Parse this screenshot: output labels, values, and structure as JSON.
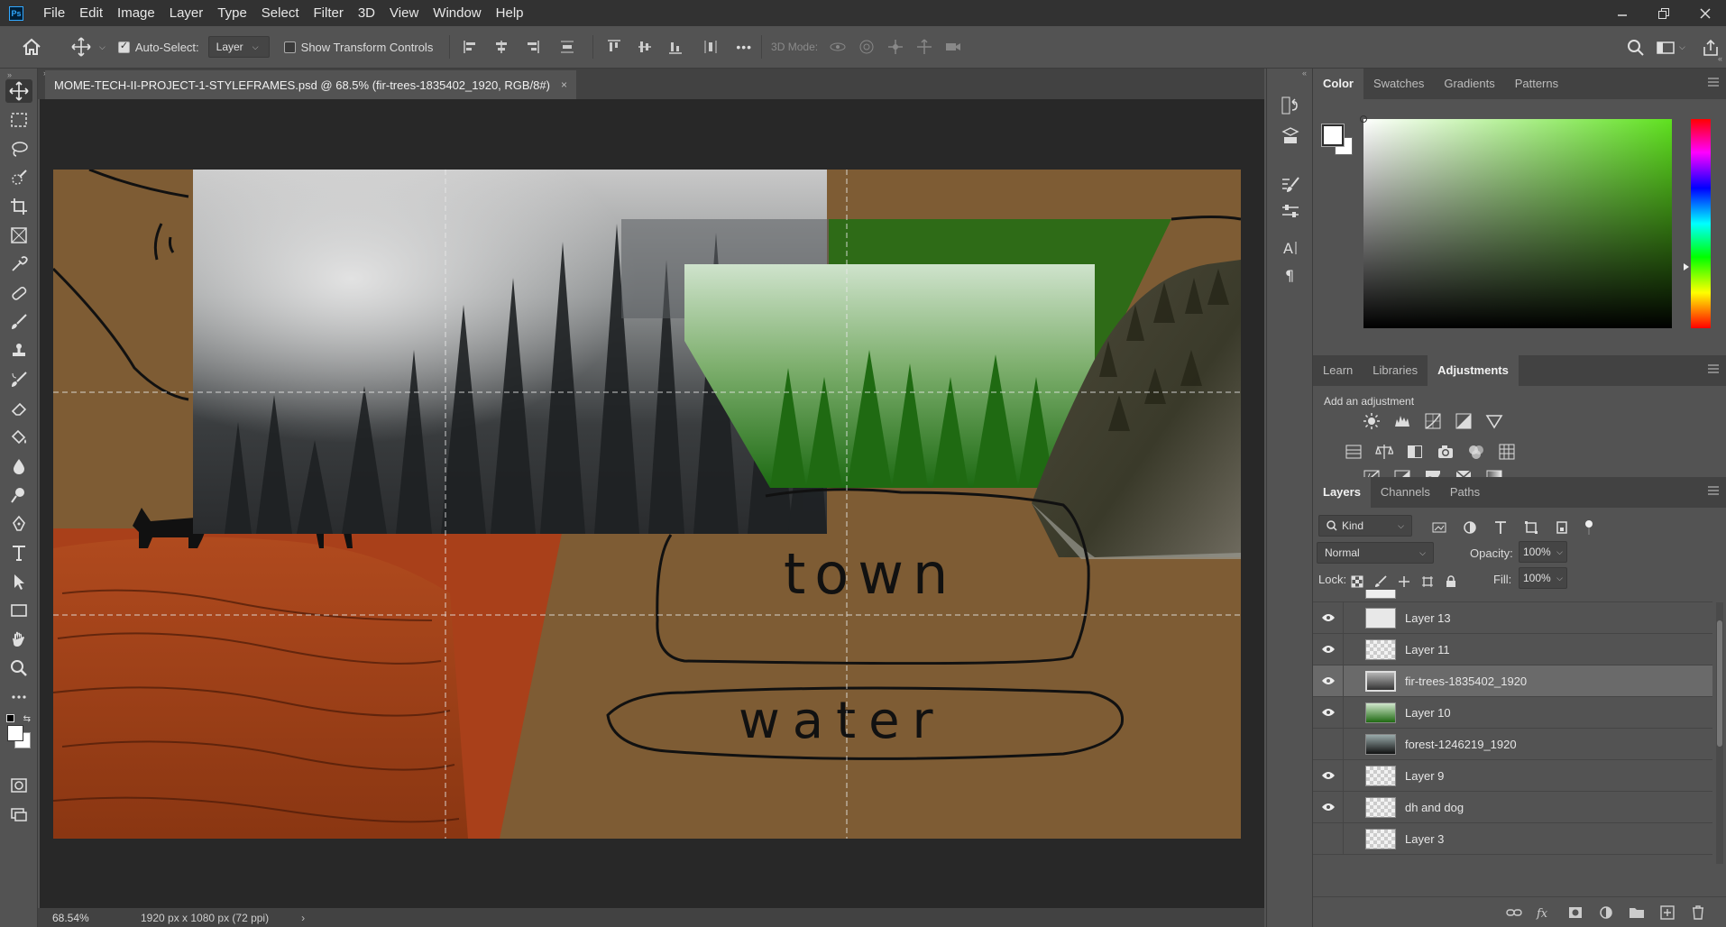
{
  "app": {
    "logo": "Ps"
  },
  "menu": [
    "File",
    "Edit",
    "Image",
    "Layer",
    "Type",
    "Select",
    "Filter",
    "3D",
    "View",
    "Window",
    "Help"
  ],
  "options": {
    "auto_select_label": "Auto-Select:",
    "auto_select_checked": true,
    "auto_select_target": "Layer",
    "show_transform_label": "Show Transform Controls",
    "show_transform_checked": false,
    "mode_3d_label": "3D Mode:",
    "more_label": "•••"
  },
  "document": {
    "tab_title": "MOME-TECH-II-PROJECT-1-STYLEFRAMES.psd @ 68.5% (fir-trees-1835402_1920, RGB/8#)",
    "close": "×",
    "canvas_text": {
      "town": "town",
      "water": "water"
    }
  },
  "status": {
    "zoom": "68.54%",
    "doc_info": "1920 px x 1080 px (72 ppi)",
    "arrow": "›"
  },
  "color_panel": {
    "tabs": [
      "Color",
      "Swatches",
      "Gradients",
      "Patterns"
    ],
    "active_tab": "Color",
    "hue_color": "#5fe11f"
  },
  "adjust_panel": {
    "tabs": [
      "Learn",
      "Libraries",
      "Adjustments"
    ],
    "active_tab": "Adjustments",
    "add_label": "Add an adjustment"
  },
  "layers_panel": {
    "tabs": [
      "Layers",
      "Channels",
      "Paths"
    ],
    "active_tab": "Layers",
    "filter_kind": "Kind",
    "blend_mode": "Normal",
    "opacity_label": "Opacity:",
    "opacity_value": "100%",
    "lock_label": "Lock:",
    "fill_label": "Fill:",
    "fill_value": "100%",
    "layers": [
      {
        "name": "Layer 13",
        "visible": true,
        "selected": false
      },
      {
        "name": "Layer 11",
        "visible": true,
        "selected": false
      },
      {
        "name": "fir-trees-1835402_1920",
        "visible": true,
        "selected": true
      },
      {
        "name": "Layer 10",
        "visible": true,
        "selected": false
      },
      {
        "name": "forest-1246219_1920",
        "visible": false,
        "selected": false
      },
      {
        "name": "Layer 9",
        "visible": true,
        "selected": false
      },
      {
        "name": "dh and dog",
        "visible": true,
        "selected": false
      },
      {
        "name": "Layer 3",
        "visible": false,
        "selected": false
      }
    ]
  },
  "icons": {
    "home": "home-icon",
    "move": "move-icon",
    "search": "search-icon",
    "eye": "eye-icon"
  }
}
